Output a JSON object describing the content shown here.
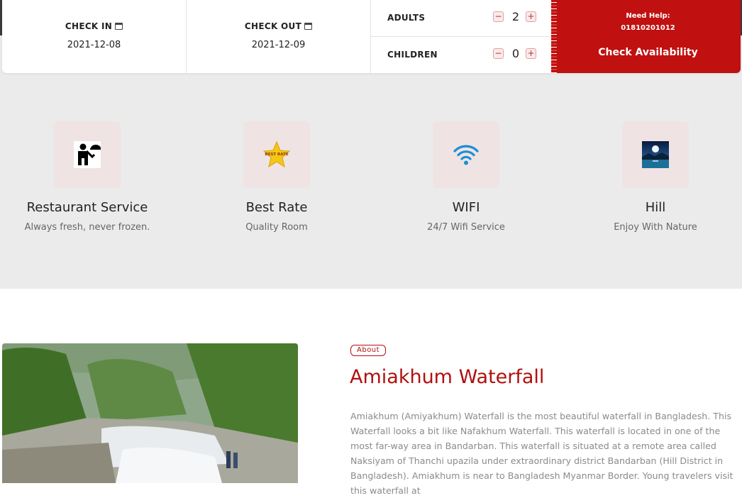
{
  "booking": {
    "check_in": {
      "label": "CHECK IN",
      "value": "2021-12-08"
    },
    "check_out": {
      "label": "CHECK OUT",
      "value": "2021-12-09"
    },
    "adults": {
      "label": "ADULTS",
      "count": "2",
      "minus": "−",
      "plus": "+"
    },
    "children": {
      "label": "CHILDREN",
      "count": "0",
      "minus": "−",
      "plus": "+"
    },
    "help_label": "Need Help:",
    "help_phone": "01810201012",
    "cta_label": "Check Availability",
    "accent_color": "#c01010"
  },
  "features": [
    {
      "title": "Restaurant Service",
      "subtitle": "Always fresh, never frozen.",
      "icon": "waiter-icon"
    },
    {
      "title": "Best Rate",
      "subtitle": "Quality Room",
      "icon": "best-rate-star-icon",
      "icon_text": "BEST RATE"
    },
    {
      "title": "WIFI",
      "subtitle": "24/7 Wifi Service",
      "icon": "wifi-icon"
    },
    {
      "title": "Hill",
      "subtitle": "Enjoy With Nature",
      "icon": "night-landscape-icon"
    }
  ],
  "about": {
    "badge": "About",
    "title": "Amiakhum Waterfall",
    "body": "Amiakhum (Amiyakhum) Waterfall is the most beautiful waterfall in Bangladesh. This Waterfall looks a bit like Nafakhum Waterfall. This waterfall is located in one of the most far-way area in Bandarban. This waterfall is situated at a remote area called Naksiyam of Thanchi upazila under extraordinary district Bandarban (Hill District in Bangladesh). Amiakhum is near to Bangladesh Myanmar Border. Young travelers visit this waterfall at",
    "image": "waterfall-photo"
  }
}
